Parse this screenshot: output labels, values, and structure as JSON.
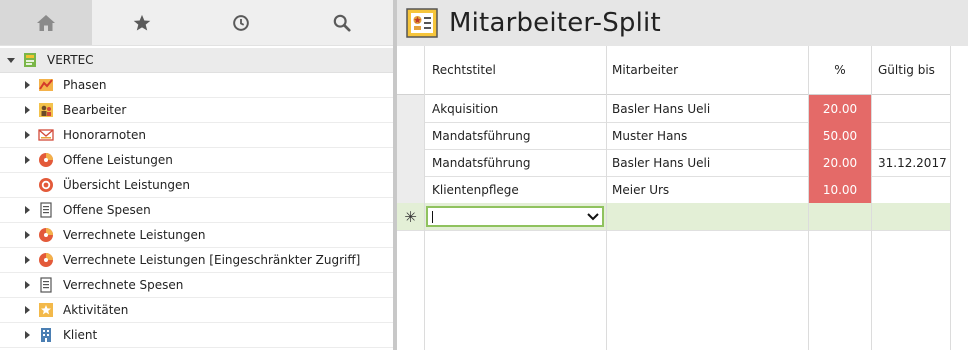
{
  "nav_tabs": [
    {
      "icon": "home-icon",
      "active": true
    },
    {
      "icon": "star-icon",
      "active": false
    },
    {
      "icon": "clock-icon",
      "active": false
    },
    {
      "icon": "search-icon",
      "active": false
    }
  ],
  "tree": {
    "root_label": "VERTEC",
    "items": [
      {
        "label": "Phasen",
        "icon": "phases-icon",
        "expandable": true
      },
      {
        "label": "Bearbeiter",
        "icon": "people-icon",
        "expandable": true
      },
      {
        "label": "Honorarnoten",
        "icon": "invoice-icon",
        "expandable": true
      },
      {
        "label": "Offene Leistungen",
        "icon": "pie-chart-icon",
        "expandable": true
      },
      {
        "label": "Übersicht Leistungen",
        "icon": "target-icon",
        "expandable": false
      },
      {
        "label": "Offene Spesen",
        "icon": "receipt-icon",
        "expandable": true
      },
      {
        "label": "Verrechnete Leistungen",
        "icon": "pie-chart-icon",
        "expandable": true
      },
      {
        "label": "Verrechnete Leistungen [Eingeschränkter Zugriff]",
        "icon": "pie-chart-icon",
        "expandable": true
      },
      {
        "label": "Verrechnete Spesen",
        "icon": "receipt-icon",
        "expandable": true
      },
      {
        "label": "Aktivitäten",
        "icon": "activity-star-icon",
        "expandable": true
      },
      {
        "label": "Klient",
        "icon": "building-icon",
        "expandable": true
      }
    ]
  },
  "page": {
    "title": "Mitarbeiter-Split"
  },
  "table": {
    "columns": [
      "Rechtstitel",
      "Mitarbeiter",
      "%",
      "Gültig bis"
    ],
    "rows": [
      {
        "rechtstitel": "Akquisition",
        "mitarbeiter": "Basler Hans Ueli",
        "pct": "20.00",
        "gueltig": ""
      },
      {
        "rechtstitel": "Mandatsführung",
        "mitarbeiter": "Muster Hans",
        "pct": "50.00",
        "gueltig": ""
      },
      {
        "rechtstitel": "Mandatsführung",
        "mitarbeiter": "Basler Hans Ueli",
        "pct": "20.00",
        "gueltig": "31.12.2017"
      },
      {
        "rechtstitel": "Klientenpflege",
        "mitarbeiter": "Meier Urs",
        "pct": "10.00",
        "gueltig": ""
      }
    ],
    "new_row_marker": "✳",
    "new_row_value": ""
  },
  "colors": {
    "pct_bg": "#e46a68",
    "new_row_bg": "#e3efd6",
    "accent_green": "#8fc25e"
  }
}
